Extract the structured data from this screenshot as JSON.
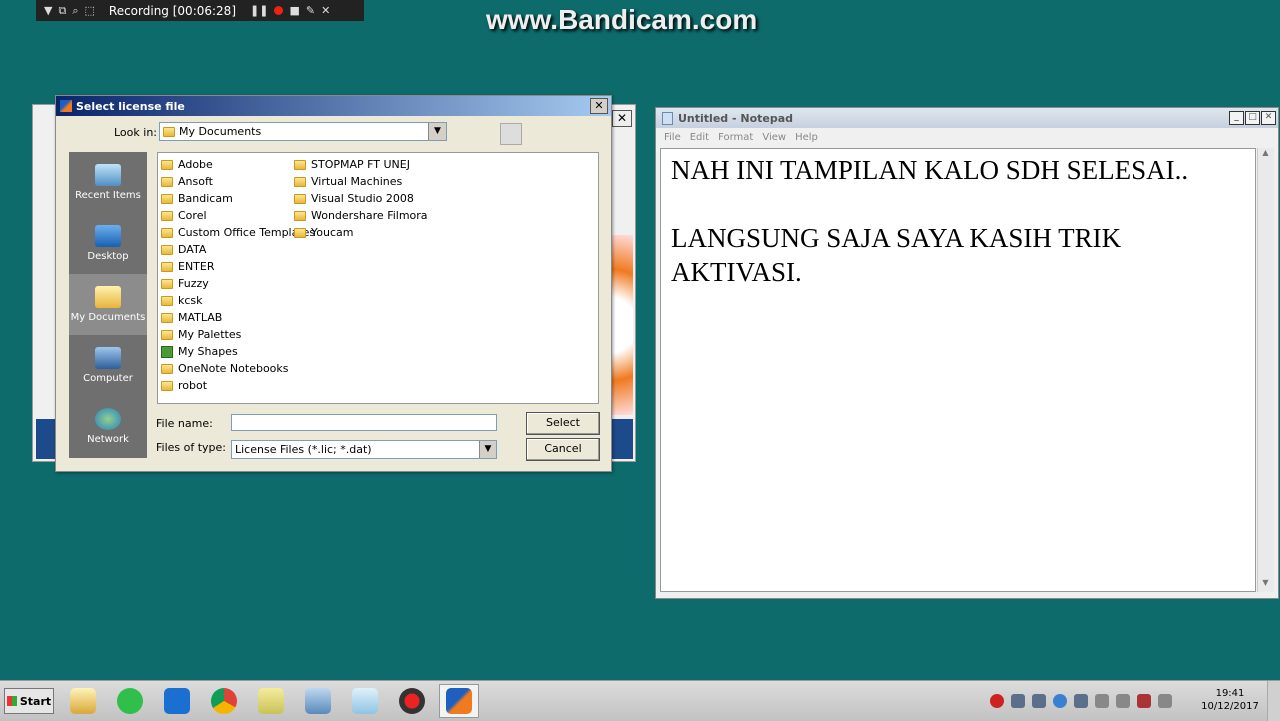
{
  "recorder": {
    "status": "Recording [00:06:28]",
    "watermark": "www.Bandicam.com"
  },
  "dialog": {
    "title": "Select license file",
    "look_in_label": "Look in:",
    "look_in_value": "My Documents",
    "places": [
      {
        "label": "Recent Items",
        "icon": "recent-items-icon"
      },
      {
        "label": "Desktop",
        "icon": "desktop-icon"
      },
      {
        "label": "My Documents",
        "icon": "my-documents-icon"
      },
      {
        "label": "Computer",
        "icon": "computer-icon"
      },
      {
        "label": "Network",
        "icon": "network-icon"
      }
    ],
    "files_col1": [
      "Adobe",
      "Ansoft",
      "Bandicam",
      "Corel",
      "Custom Office Templates",
      "DATA",
      "ENTER",
      "Fuzzy",
      "kcsk",
      "MATLAB",
      "My Palettes",
      "My Shapes",
      "OneNote Notebooks",
      "robot"
    ],
    "files_col2": [
      "STOPMAP FT UNEJ",
      "Virtual Machines",
      "Visual Studio 2008",
      "Wondershare Filmora",
      "Youcam"
    ],
    "file_name_label": "File name:",
    "file_name_value": "",
    "files_of_type_label": "Files of type:",
    "files_of_type_value": "License Files (*.lic; *.dat)",
    "select_label": "Select",
    "cancel_label": "Cancel"
  },
  "notepad": {
    "title": "Untitled - Notepad",
    "menu": [
      "File",
      "Edit",
      "Format",
      "View",
      "Help"
    ],
    "content": "NAH INI TAMPILAN KALO SDH SELESAI..\n\nLANGSUNG SAJA SAYA KASIH TRIK AKTIVASI."
  },
  "taskbar": {
    "start_label": "Start",
    "apps": [
      "explorer-icon",
      "whatsapp-icon",
      "maxthon-icon",
      "chrome-icon",
      "folder-icon",
      "control-panel-icon",
      "notepad-icon",
      "bandicam-icon",
      "matlab-icon"
    ],
    "time": "19:41",
    "date": "10/12/2017"
  },
  "colors": {
    "desktop": "#0e6b6b",
    "title_active": "#0a246a",
    "matlab_orange": "#f07a20"
  }
}
